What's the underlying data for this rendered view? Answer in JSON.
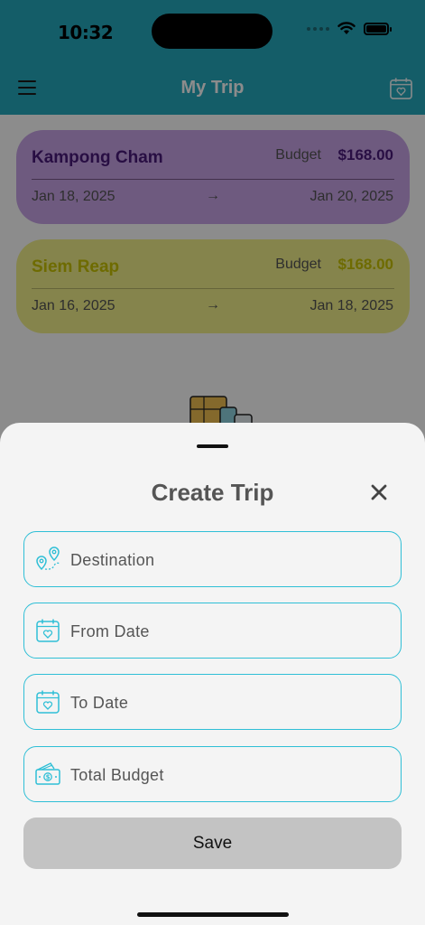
{
  "status": {
    "time": "10:32"
  },
  "app_bar": {
    "title": "My Trip"
  },
  "trips": [
    {
      "destination": "Kampong Cham",
      "budget_label": "Budget",
      "budget": "$168.00",
      "from": "Jan 18, 2025",
      "arrow": "→",
      "to": "Jan 20, 2025"
    },
    {
      "destination": "Siem Reap",
      "budget_label": "Budget",
      "budget": "$168.00",
      "from": "Jan 16, 2025",
      "arrow": "→",
      "to": "Jan 18, 2025"
    }
  ],
  "sheet": {
    "title": "Create Trip",
    "fields": [
      {
        "label": "Destination",
        "icon": "map-pin-route-icon"
      },
      {
        "label": "From Date",
        "icon": "calendar-heart-icon"
      },
      {
        "label": "To Date",
        "icon": "calendar-heart-icon"
      },
      {
        "label": "Total Budget",
        "icon": "money-icon"
      }
    ],
    "save_label": "Save"
  },
  "colors": {
    "accent": "#26a9be",
    "field_border": "#2fbfd6",
    "card_purple": "#c8a5e8",
    "card_yellow": "#f2f08a",
    "save_bg": "#c3c3c3"
  }
}
